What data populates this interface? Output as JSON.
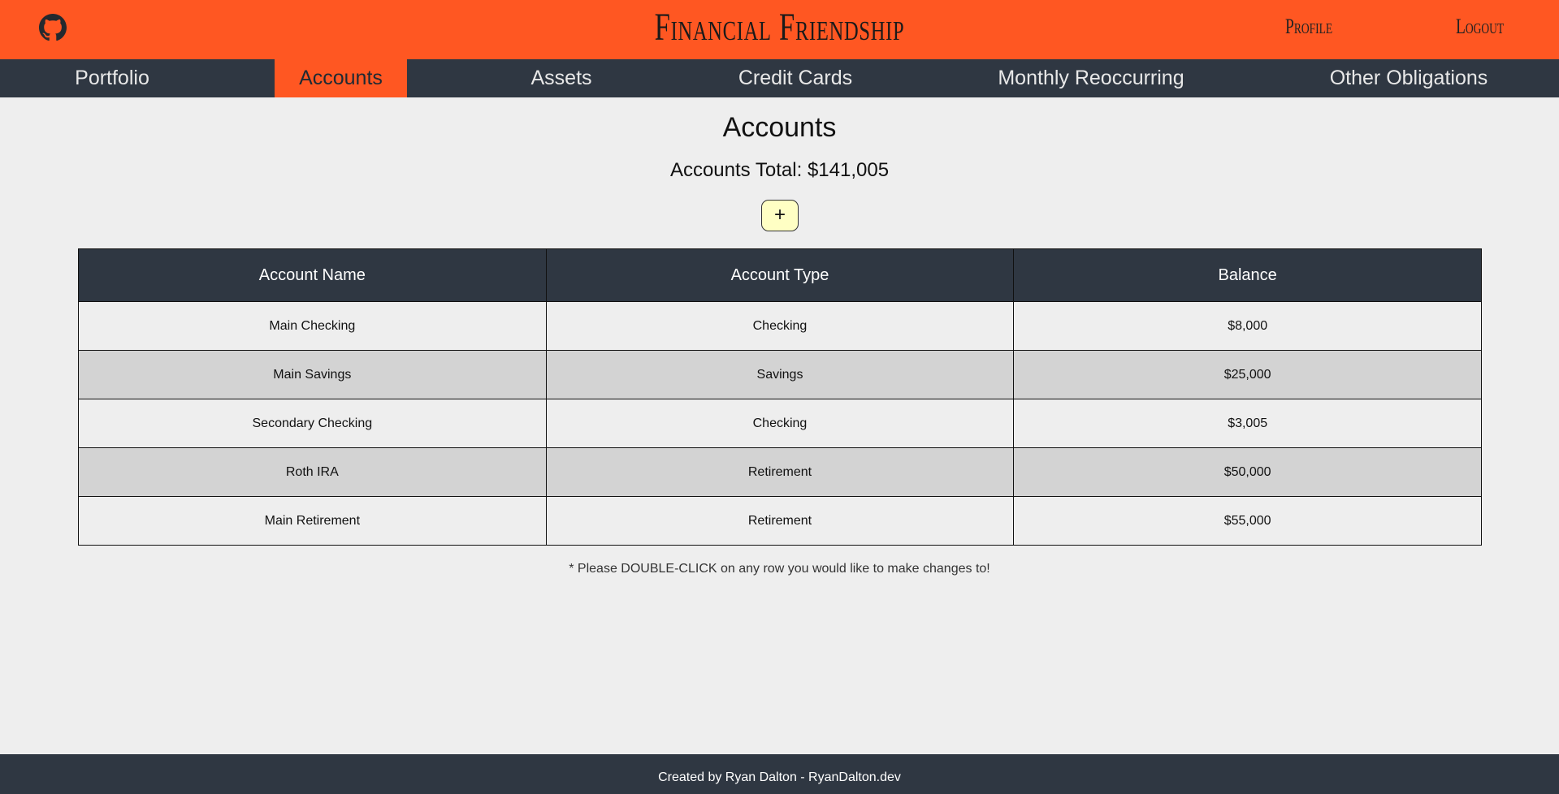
{
  "header": {
    "brand": "Financial Friendship",
    "github_icon": "github-icon",
    "profile_label": "Profile",
    "logout_label": "Logout",
    "accent_color": "#ff5722",
    "dark_color": "#2f3742"
  },
  "nav": {
    "items": [
      {
        "label": "Portfolio"
      },
      {
        "label": "Accounts",
        "active": true
      },
      {
        "label": "Assets"
      },
      {
        "label": "Credit Cards"
      },
      {
        "label": "Monthly Reoccurring"
      },
      {
        "label": "Other Obligations"
      }
    ]
  },
  "main": {
    "title": "Accounts",
    "total": "Accounts Total: $141,005",
    "add_label": "+",
    "add_button_color": "#ffffc4",
    "table": {
      "headers": [
        "Account Name",
        "Account Type",
        "Balance"
      ],
      "rows": [
        [
          "Main Checking",
          "Checking",
          "$8,000"
        ],
        [
          "Main Savings",
          "Savings",
          "$25,000"
        ],
        [
          "Secondary Checking",
          "Checking",
          "$3,005"
        ],
        [
          "Roth IRA",
          "Retirement",
          "$50,000"
        ],
        [
          "Main Retirement",
          "Retirement",
          "$55,000"
        ]
      ]
    },
    "hint": "* Please DOUBLE-CLICK on any row you would like to make changes to!"
  },
  "footer": {
    "credit": "Created by Ryan Dalton - RyanDalton.dev"
  }
}
